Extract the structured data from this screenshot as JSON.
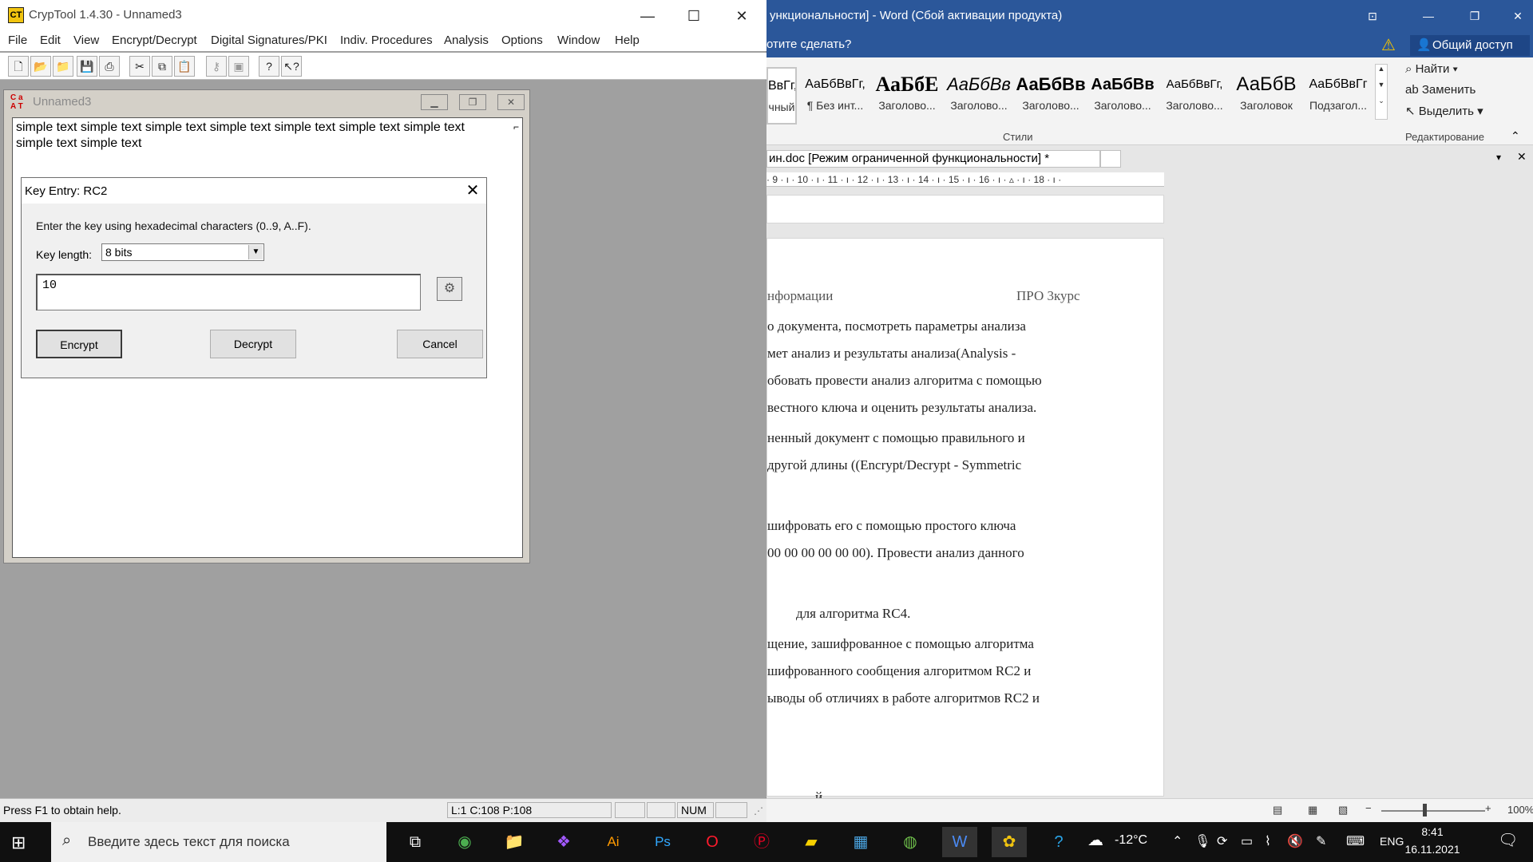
{
  "word": {
    "title": "ункциональности] - Word (Сбой активации продукта)",
    "tellme": "отите сделать?",
    "share_label": "Общий доступ",
    "styles": [
      {
        "sample": "ВвГг,",
        "name": "чный"
      },
      {
        "sample": "АаБбВвГг,",
        "name": "¶ Без инт..."
      },
      {
        "sample": "АаБбЕ",
        "name": "Заголово..."
      },
      {
        "sample": "АаБбВв",
        "name": "Заголово..."
      },
      {
        "sample": "АаБбВв",
        "name": "Заголово..."
      },
      {
        "sample": "АаБбВв",
        "name": "Заголово..."
      },
      {
        "sample": "АаБбВвГг,",
        "name": "Заголово..."
      },
      {
        "sample": "АаБбВ",
        "name": "Заголовок"
      },
      {
        "sample": "АаБбВвГг",
        "name": "Подзагол..."
      }
    ],
    "styles_label": "Стили",
    "editing": {
      "find": "Найти",
      "replace": "Заменить",
      "select": "Выделить",
      "label": "Редактирование"
    },
    "doc_tab": "ин.doc [Режим ограниченной функциональности] *",
    "ruler": "· 9 · ı · 10 · ı · 11 · ı · 12 · ı · 13 · ı · 14 · ı · 15 · ı · 16 · ı · ▵ · ı · 18 · ı ·",
    "header_left": "нформации",
    "header_right": "ПРО 3курс",
    "lines": [
      "о  документа,  посмотреть  параметры  анализа",
      "мет  анализ  и  результаты  анализа(Analysis  -",
      "обовать провести анализ алгоритма с помощью",
      "вестного ключа и оценить результаты анализа.",
      "ненный  документ  с  помощью  правильного  и",
      "другой  длины  ((Encrypt/Decrypt  -  Symmetric",
      "шифровать  его  с  помощью  простого  ключа",
      "00  00  00  00  00  00).  Провести  анализ  данного",
      "для алгоритма RC4.",
      "щение,  зашифрованное  с  помощью  алгоритма",
      "шифрованного  сообщения  алгоритмом  RC2  и",
      "ыводы об отличиях в работе алгоритмов RC2 и",
      "й"
    ],
    "zoom": "100%"
  },
  "cryptool": {
    "title": "CrypTool 1.4.30 - Unnamed3",
    "menu": [
      "File",
      "Edit",
      "View",
      "Encrypt/Decrypt",
      "Digital Signatures/PKI",
      "Indiv. Procedures",
      "Analysis",
      "Options",
      "Window",
      "Help"
    ],
    "child_title": "Unnamed3",
    "child_text": "simple text simple text simple text simple text simple text simple text simple text simple text simple text",
    "status_help": "Press F1 to obtain help.",
    "status_pos": "L:1  C:108  P:108",
    "status_num": "NUM"
  },
  "dialog": {
    "title": "Key Entry: RC2",
    "instruction": "Enter the key using hexadecimal characters (0..9, A..F).",
    "key_length_label": "Key length:",
    "key_length_value": "8 bits",
    "key_value": "10",
    "encrypt": "Encrypt",
    "decrypt": "Decrypt",
    "cancel": "Cancel"
  },
  "taskbar": {
    "search_placeholder": "Введите здесь текст для поиска",
    "weather": "-12°C",
    "lang": "ENG",
    "time": "8:41",
    "date": "16.11.2021"
  }
}
